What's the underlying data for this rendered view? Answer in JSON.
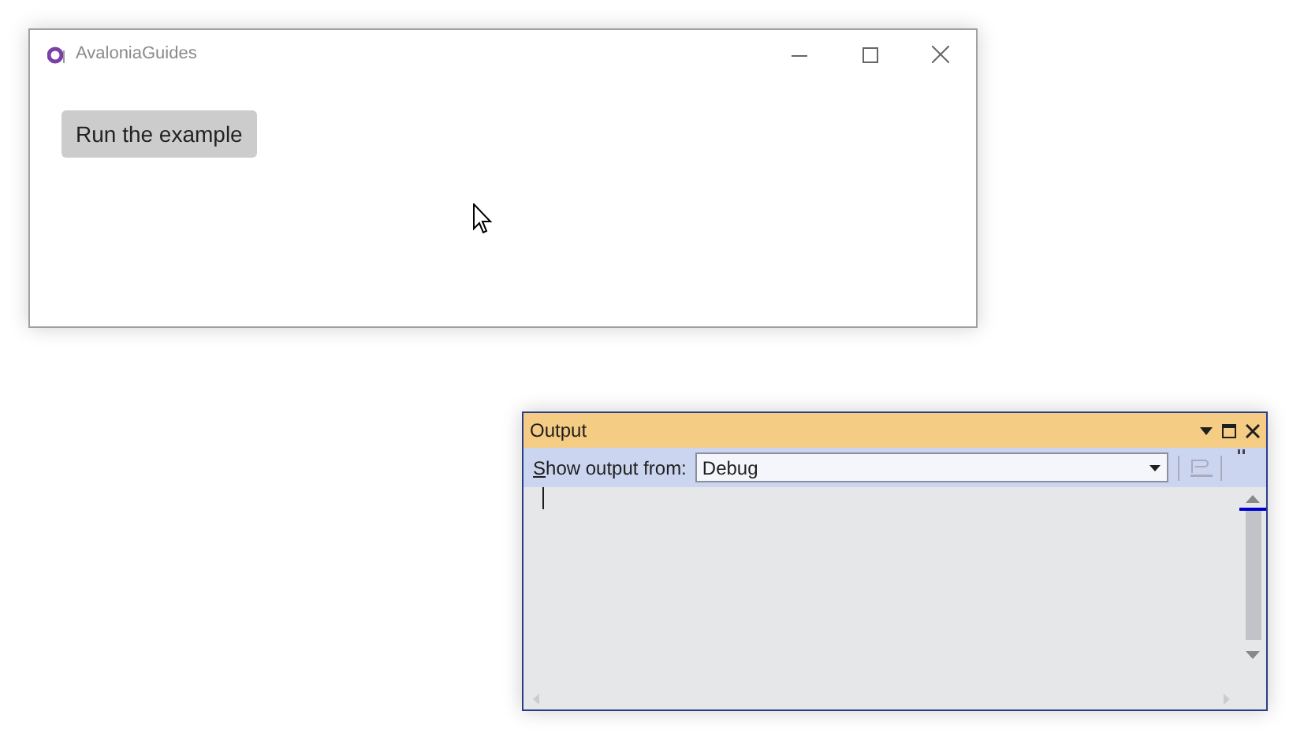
{
  "app_window": {
    "title": "AvaloniaGuides",
    "button": "Run the example"
  },
  "output_window": {
    "title": "Output",
    "source_label": "Show output from:",
    "access_key_underlined": true,
    "source": "Debug"
  }
}
